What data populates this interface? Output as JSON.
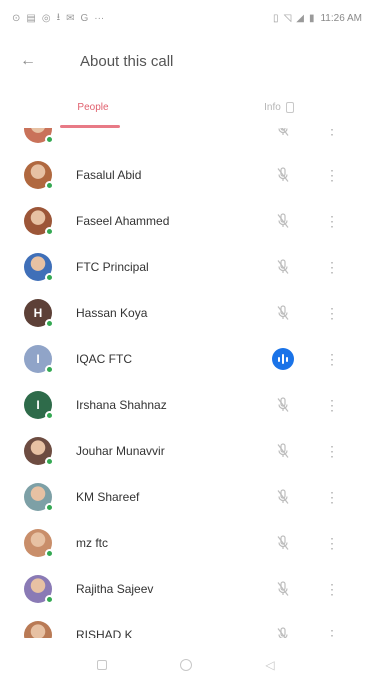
{
  "status_bar": {
    "left_icons": [
      "notification-icon",
      "message-icon",
      "whatsapp-icon",
      "download-icon",
      "mail-icon",
      "google-icon",
      "more-icon"
    ],
    "left_glyphs": [
      "⊙",
      "▤",
      "◎",
      "⭳",
      "✉",
      "G",
      "···"
    ],
    "right_glyphs": [
      "▯",
      "◹",
      "◢",
      "▮"
    ],
    "time": "11:26 AM"
  },
  "app_bar": {
    "title": "About this call",
    "back_glyph": "←"
  },
  "tabs": [
    {
      "label": "People",
      "selected": true
    },
    {
      "label": "Info",
      "selected": false
    }
  ],
  "participants": [
    {
      "name": "",
      "avatar": "photo",
      "color": "#c9725a",
      "mic": "muted"
    },
    {
      "name": "Fasalul Abid",
      "avatar": "photo",
      "color": "#b0683f",
      "mic": "muted"
    },
    {
      "name": "Faseel Ahammed",
      "avatar": "photo",
      "color": "#9c5638",
      "mic": "muted"
    },
    {
      "name": "FTC Principal",
      "avatar": "photo",
      "color": "#3f6fb8",
      "mic": "muted"
    },
    {
      "name": "Hassan Koya",
      "avatar": "H",
      "color": "#5d4037",
      "mic": "muted"
    },
    {
      "name": "IQAC FTC",
      "avatar": "I",
      "color": "#90a4c8",
      "mic": "active"
    },
    {
      "name": "Irshana Shahnaz",
      "avatar": "I",
      "color": "#2e6b4a",
      "mic": "muted"
    },
    {
      "name": "Jouhar Munavvir",
      "avatar": "photo",
      "color": "#6d4c41",
      "mic": "muted"
    },
    {
      "name": "KM Shareef",
      "avatar": "photo",
      "color": "#7da0a6",
      "mic": "muted"
    },
    {
      "name": "mz ftc",
      "avatar": "photo",
      "color": "#c98e6a",
      "mic": "muted"
    },
    {
      "name": "Rajitha Sajeev",
      "avatar": "photo",
      "color": "#8a7ab5",
      "mic": "muted"
    },
    {
      "name": "RISHAD K",
      "avatar": "photo",
      "color": "#b97a55",
      "mic": "muted"
    }
  ],
  "nav_bar": [
    "recents",
    "home",
    "back"
  ]
}
